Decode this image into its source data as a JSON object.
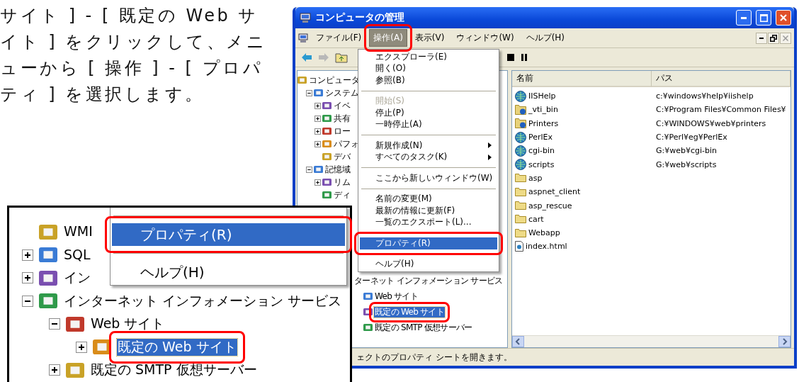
{
  "instruction": "サイト ] - [ 既定の Web サイト ] をクリックして、メニューから [ 操作 ] - [ プロパティ ] を選択します。",
  "window": {
    "title": "コンピュータの管理",
    "menu_bar": [
      {
        "label": "ファイル(F)",
        "selected": false
      },
      {
        "label": "操作(A)",
        "selected": true
      },
      {
        "label": "表示(V)",
        "selected": false
      },
      {
        "label": "ウィンドウ(W)",
        "selected": false
      },
      {
        "label": "ヘルプ(H)",
        "selected": false
      }
    ],
    "tree": [
      {
        "label": "コンピュータ",
        "selected": false,
        "children": [
          {
            "label": "システム",
            "expanded": true,
            "selected": false,
            "children": [
              {
                "label": "イベ",
                "expanded": false,
                "selected": false
              },
              {
                "label": "共有",
                "expanded": false,
                "selected": false
              },
              {
                "label": "ロー",
                "expanded": false,
                "selected": false
              },
              {
                "label": "パフォ",
                "expanded": false,
                "selected": false
              },
              {
                "label": "デバ",
                "selected": false
              }
            ]
          },
          {
            "label": "記憶域",
            "expanded": true,
            "selected": false,
            "children": [
              {
                "label": "リム",
                "expanded": false,
                "selected": false
              },
              {
                "label": "ディ",
                "selected": false
              }
            ]
          }
        ]
      }
    ],
    "tree_continued": [
      {
        "label": "ターネット インフォメーション サービス",
        "selected": false,
        "children": [
          {
            "label": "Web サイト",
            "selected": false
          },
          {
            "label": "既定の Web サイト",
            "selected": true
          },
          {
            "label": "既定の SMTP 仮想サーバー",
            "selected": false
          }
        ]
      }
    ],
    "action_menu": [
      {
        "kind": "item",
        "label": "エクスプローラ(E)",
        "disabled": false,
        "selected": false
      },
      {
        "kind": "item",
        "label": "開く(O)",
        "disabled": false,
        "selected": false
      },
      {
        "kind": "item",
        "label": "参照(B)",
        "disabled": false,
        "selected": false
      },
      {
        "kind": "separator"
      },
      {
        "kind": "item",
        "label": "開始(S)",
        "disabled": true,
        "selected": false
      },
      {
        "kind": "item",
        "label": "停止(P)",
        "disabled": false,
        "selected": false
      },
      {
        "kind": "item",
        "label": "一時停止(A)",
        "disabled": false,
        "selected": false
      },
      {
        "kind": "separator"
      },
      {
        "kind": "submenu",
        "label": "新規作成(N)",
        "disabled": false,
        "selected": false
      },
      {
        "kind": "submenu",
        "label": "すべてのタスク(K)",
        "disabled": false,
        "selected": false
      },
      {
        "kind": "separator"
      },
      {
        "kind": "item",
        "label": "ここから新しいウィンドウ(W)",
        "disabled": false,
        "selected": false
      },
      {
        "kind": "separator"
      },
      {
        "kind": "item",
        "label": "名前の変更(M)",
        "disabled": false,
        "selected": false
      },
      {
        "kind": "item",
        "label": "最新の情報に更新(F)",
        "disabled": false,
        "selected": false
      },
      {
        "kind": "item",
        "label": "一覧のエクスポート(L)...",
        "disabled": false,
        "selected": false
      },
      {
        "kind": "separator"
      },
      {
        "kind": "item",
        "label": "プロパティ(R)",
        "disabled": false,
        "selected": true
      },
      {
        "kind": "separator"
      },
      {
        "kind": "item",
        "label": "ヘルプ(H)",
        "disabled": false,
        "selected": false
      }
    ],
    "list": {
      "columns": [
        "名前",
        "パス"
      ],
      "rows": [
        {
          "kind": "app",
          "name": "IISHelp",
          "path": "c:¥windows¥help¥iishelp"
        },
        {
          "kind": "virtual_dir",
          "name": "_vti_bin",
          "path": "C:¥Program Files¥Common Files¥"
        },
        {
          "kind": "virtual_dir",
          "name": "Printers",
          "path": "C:¥WINDOWS¥web¥printers"
        },
        {
          "kind": "app",
          "name": "PerlEx",
          "path": "C:¥Perl¥eg¥PerlEx"
        },
        {
          "kind": "app",
          "name": "cgi-bin",
          "path": "G:¥web¥cgi-bin"
        },
        {
          "kind": "app",
          "name": "scripts",
          "path": "G:¥web¥scripts"
        },
        {
          "kind": "folder",
          "name": "asp"
        },
        {
          "kind": "folder",
          "name": "aspnet_client"
        },
        {
          "kind": "folder",
          "name": "asp_rescue"
        },
        {
          "kind": "folder",
          "name": "cart"
        },
        {
          "kind": "folder",
          "name": "Webapp"
        },
        {
          "kind": "file",
          "name": "index.html"
        }
      ]
    },
    "status_bar": "ェクトのプロパティ シートを開きます。"
  },
  "inset": {
    "context_menu": [
      {
        "kind": "separator"
      },
      {
        "kind": "item",
        "label": "プロパティ(R)",
        "selected": true
      },
      {
        "kind": "separator"
      },
      {
        "kind": "item",
        "label": "ヘルプ(H)",
        "selected": false
      }
    ],
    "tree": [
      {
        "label": "WMI",
        "selected": false
      },
      {
        "label": "SQL",
        "expanded": false,
        "selected": false
      },
      {
        "label": "イン",
        "expanded": false,
        "selected": false
      },
      {
        "label": "インターネット インフォメーション サービス",
        "expanded": true,
        "selected": false,
        "children": [
          {
            "label": "Web サイト",
            "expanded": true,
            "selected": false,
            "children": [
              {
                "label": "既定の Web サイト",
                "expanded": false,
                "selected": true
              }
            ]
          },
          {
            "label": "既定の SMTP 仮想サーバー",
            "expanded": false,
            "selected": false
          }
        ]
      }
    ]
  }
}
